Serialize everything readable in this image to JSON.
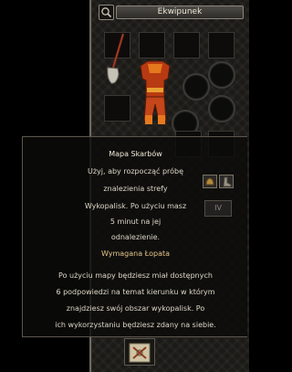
{
  "window": {
    "title": "Ekwipunek"
  },
  "tooltip": {
    "item_name": "Mapa Skarbów",
    "lines": [
      "Użyj, aby rozpocząć próbę",
      "znalezienia strefy",
      "Wykopalisk. Po użyciu masz",
      "5 minut na jej",
      "odnalezienie."
    ],
    "requirement": "Wymagana Łopata",
    "description": [
      "Po użyciu mapy będziesz miał dostępnych",
      "6 podpowiedzi na temat kierunku w którym",
      "znajdziesz swój obszar wykopalisk. Po",
      "ich wykorzystaniu będziesz zdany na siebie."
    ]
  },
  "tier": {
    "label": "IV"
  },
  "icons": {
    "search": "magnifier-icon",
    "weapon": "shovel-icon",
    "body": "armor-icon",
    "map": "treasure-map-icon",
    "tooltip_small_a": "helmet-icon",
    "tooltip_small_b": "boot-icon"
  },
  "colors": {
    "window_background": "#1b1a17",
    "tooltip_text": "#ddd7c6",
    "requirement_text": "#e3c488",
    "armor_red": "#b83a12",
    "armor_orange": "#e5781d"
  }
}
